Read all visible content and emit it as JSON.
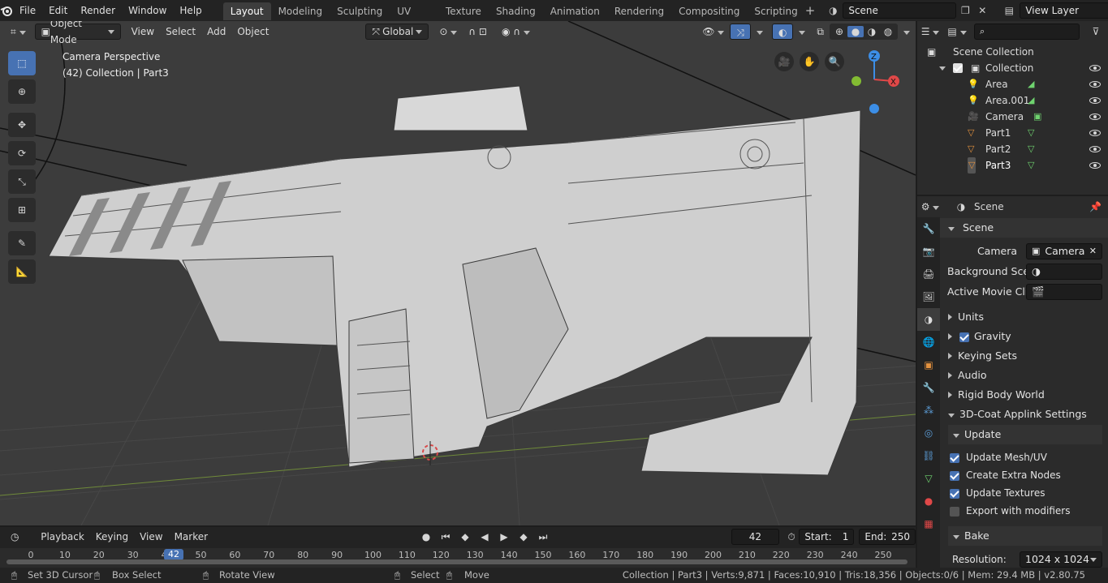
{
  "topbar": {
    "menus": [
      "File",
      "Edit",
      "Render",
      "Window",
      "Help"
    ],
    "workspaces": [
      "Layout",
      "Modeling",
      "Sculpting",
      "UV Editing",
      "Texture Paint",
      "Shading",
      "Animation",
      "Rendering",
      "Compositing",
      "Scripting"
    ],
    "active_workspace": "Layout",
    "scene_name": "Scene",
    "view_layer": "View Layer"
  },
  "viewport": {
    "mode": "Object Mode",
    "menus": [
      "View",
      "Select",
      "Add",
      "Object"
    ],
    "orientation": "Global",
    "overlay_title": "Camera Perspective",
    "overlay_subtitle": "(42) Collection | Part3",
    "gizmo": {
      "z": "Z",
      "x": "X"
    }
  },
  "outliner": {
    "search_placeholder": "",
    "root": "Scene Collection",
    "collection": "Collection",
    "items": [
      {
        "name": "Area",
        "type": "light"
      },
      {
        "name": "Area.001",
        "type": "light"
      },
      {
        "name": "Camera",
        "type": "camera"
      },
      {
        "name": "Part1",
        "type": "mesh"
      },
      {
        "name": "Part2",
        "type": "mesh"
      },
      {
        "name": "Part3",
        "type": "mesh",
        "selected": true
      }
    ]
  },
  "properties": {
    "context": "Scene",
    "panel_scene": "Scene",
    "camera_label": "Camera",
    "camera_value": "Camera",
    "background_label": "Background Sce..",
    "movie_clip_label": "Active Movie Clip",
    "units": "Units",
    "gravity": "Gravity",
    "keying_sets": "Keying Sets",
    "audio": "Audio",
    "rigid_body": "Rigid Body World",
    "applink": "3D-Coat Applink Settings",
    "update": "Update",
    "update_mesh": "Update Mesh/UV",
    "create_nodes": "Create Extra Nodes",
    "update_textures": "Update Textures",
    "export_modifiers": "Export with modifiers",
    "bake": "Bake",
    "resolution_label": "Resolution:",
    "resolution_value": "1024 x 1024"
  },
  "timeline": {
    "menus": [
      "Playback",
      "Keying",
      "View",
      "Marker"
    ],
    "current_frame": "42",
    "start_label": "Start:",
    "start": "1",
    "end_label": "End:",
    "end": "250",
    "ticks": [
      "0",
      "10",
      "20",
      "30",
      "40",
      "50",
      "60",
      "70",
      "80",
      "90",
      "100",
      "110",
      "120",
      "130",
      "140",
      "150",
      "160",
      "170",
      "180",
      "190",
      "200",
      "210",
      "220",
      "230",
      "240",
      "250"
    ],
    "playhead": "42"
  },
  "status": {
    "hint1": "Set 3D Cursor",
    "hint2": "Box Select",
    "hint3": "Rotate View",
    "hint4": "Select",
    "hint5": "Move",
    "stats": "Collection | Part3 | Verts:9,871 | Faces:10,910 | Tris:18,356 | Objects:0/6 | Mem: 29.4 MB | v2.80.75"
  },
  "colors": {
    "accent": "#4772b3",
    "mesh_icon": "#6fd36f",
    "obj_icon": "#e3913e",
    "gizmo_x": "#e04848",
    "gizmo_y": "#82bb32",
    "gizmo_z": "#3c8ee6"
  }
}
